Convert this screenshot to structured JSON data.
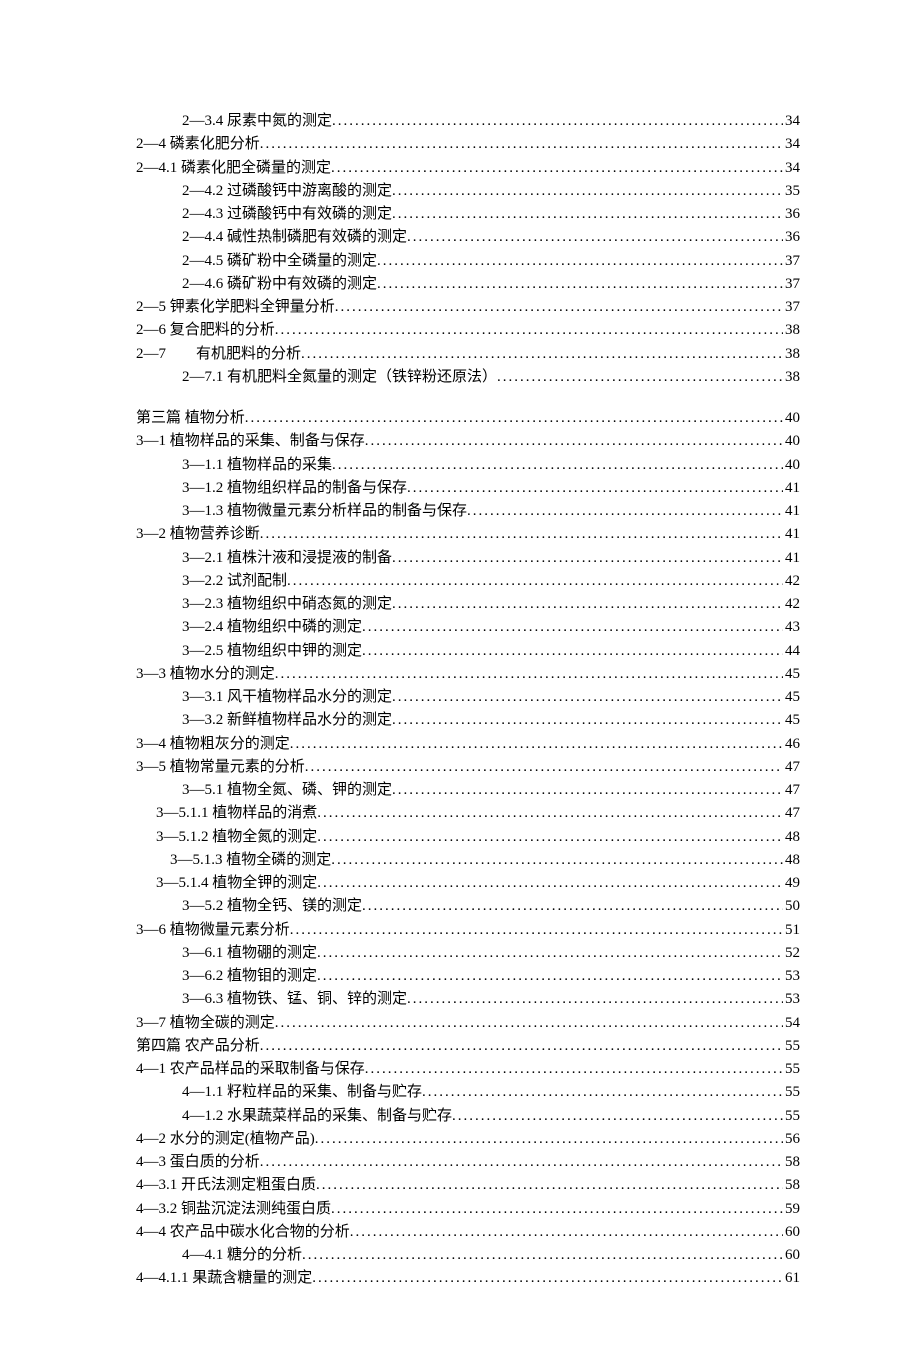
{
  "toc": [
    {
      "indent": "ind2",
      "label": "2—3.4  尿素中氮的测定",
      "page": "34"
    },
    {
      "indent": "ind1",
      "label": "2—4  磷素化肥分析",
      "page": "34"
    },
    {
      "indent": "ind1",
      "label": "2—4.1  磷素化肥全磷量的测定",
      "page": "34"
    },
    {
      "indent": "ind2",
      "label": "2—4.2  过磷酸钙中游离酸的测定",
      "page": "35"
    },
    {
      "indent": "ind2",
      "label": "2—4.3  过磷酸钙中有效磷的测定",
      "page": "36"
    },
    {
      "indent": "ind2",
      "label": "2—4.4  碱性热制磷肥有效磷的测定",
      "page": "36"
    },
    {
      "indent": "ind2",
      "label": "2—4.5  磷矿粉中全磷量的测定",
      "page": "37"
    },
    {
      "indent": "ind2",
      "label": "2—4.6  磷矿粉中有效磷的测定",
      "page": "37"
    },
    {
      "indent": "ind1",
      "label": "2—5  钾素化学肥料全钾量分析",
      "page": "37"
    },
    {
      "indent": "ind1",
      "label": "2—6  复合肥料的分析",
      "page": "38"
    },
    {
      "indent": "ind1",
      "label": "2—7　　有机肥料的分析",
      "page": "38"
    },
    {
      "indent": "ind2",
      "label": "2—7.1 有机肥料全氮量的测定（铁锌粉还原法）",
      "page": "38"
    },
    {
      "indent": "spacer",
      "label": "",
      "page": ""
    },
    {
      "indent": "ind1",
      "label": "第三篇  植物分析",
      "page": "40"
    },
    {
      "indent": "ind1",
      "label": "3—1  植物样品的采集、制备与保存",
      "page": "40"
    },
    {
      "indent": "ind2",
      "label": "3—1.1  植物样品的采集",
      "page": "40"
    },
    {
      "indent": "ind2",
      "label": "3—1.2  植物组织样品的制备与保存",
      "page": "41"
    },
    {
      "indent": "ind2",
      "label": "3—1.3  植物微量元素分析样品的制备与保存",
      "page": "41"
    },
    {
      "indent": "ind1",
      "label": "3—2  植物营养诊断",
      "page": "41"
    },
    {
      "indent": "ind2",
      "label": "3—2.1  植株汁液和浸提液的制备",
      "page": "41"
    },
    {
      "indent": "ind2",
      "label": "3—2.2  试剂配制",
      "page": "42"
    },
    {
      "indent": "ind2",
      "label": "3—2.3  植物组织中硝态氮的测定",
      "page": "42"
    },
    {
      "indent": "ind2",
      "label": "3—2.4  植物组织中磷的测定",
      "page": "43"
    },
    {
      "indent": "ind2",
      "label": "3—2.5  植物组织中钾的测定",
      "page": "44"
    },
    {
      "indent": "ind1",
      "label": "3—3  植物水分的测定",
      "page": "45"
    },
    {
      "indent": "ind2",
      "label": "3—3.1  风干植物样品水分的测定",
      "page": "45"
    },
    {
      "indent": "ind2",
      "label": "3—3.2  新鲜植物样品水分的测定",
      "page": "45"
    },
    {
      "indent": "ind1",
      "label": "3—4  植物粗灰分的测定",
      "page": "46"
    },
    {
      "indent": "ind1",
      "label": "3—5  植物常量元素的分析",
      "page": "47"
    },
    {
      "indent": "ind2",
      "label": "3—5.1  植物全氮、磷、钾的测定",
      "page": "47"
    },
    {
      "indent": "ind3",
      "label": "3—5.1.1  植物样品的消煮",
      "page": "47"
    },
    {
      "indent": "ind3",
      "label": "3—5.1.2  植物全氮的测定",
      "page": "48"
    },
    {
      "indent": "ind2b",
      "label": "3—5.1.3  植物全磷的测定",
      "page": "48"
    },
    {
      "indent": "ind3",
      "label": "3—5.1.4  植物全钾的测定",
      "page": "49"
    },
    {
      "indent": "ind2",
      "label": "3—5.2  植物全钙、镁的测定",
      "page": "50"
    },
    {
      "indent": "ind1",
      "label": "3—6  植物微量元素分析",
      "page": "51"
    },
    {
      "indent": "ind2",
      "label": "3—6.1  植物硼的测定",
      "page": "52"
    },
    {
      "indent": "ind2",
      "label": "3—6.2  植物钼的测定",
      "page": "53"
    },
    {
      "indent": "ind2",
      "label": "3—6.3  植物铁、锰、铜、锌的测定",
      "page": "53"
    },
    {
      "indent": "ind1",
      "label": "3—7  植物全碳的测定",
      "page": "54"
    },
    {
      "indent": "ind1",
      "label": "第四篇  农产品分析",
      "page": "55"
    },
    {
      "indent": "ind1",
      "label": " 4—1  农产品样品的采取制备与保存",
      "page": "55"
    },
    {
      "indent": "ind2",
      "label": "4—1.1  籽粒样品的采集、制备与贮存",
      "page": "55"
    },
    {
      "indent": "ind2",
      "label": "4—1.2  水果蔬菜样品的采集、制备与贮存",
      "page": "55"
    },
    {
      "indent": "ind1",
      "label": " 4—2  水分的测定(植物产品)",
      "page": "56"
    },
    {
      "indent": "ind1",
      "label": " 4—3  蛋白质的分析",
      "page": "58"
    },
    {
      "indent": "ind1",
      "label": "  4—3.1 开氏法测定粗蛋白质",
      "page": "58"
    },
    {
      "indent": "ind1",
      "label": "  4—3.2 铜盐沉淀法测纯蛋白质",
      "page": "59"
    },
    {
      "indent": "ind1",
      "label": " 4—4  农产品中碳水化合物的分析",
      "page": "60"
    },
    {
      "indent": "ind2",
      "label": "4—4.1  糖分的分析",
      "page": "60"
    },
    {
      "indent": "ind1",
      "label": "   4—4.1.1  果蔬含糖量的测定",
      "page": "61"
    }
  ]
}
